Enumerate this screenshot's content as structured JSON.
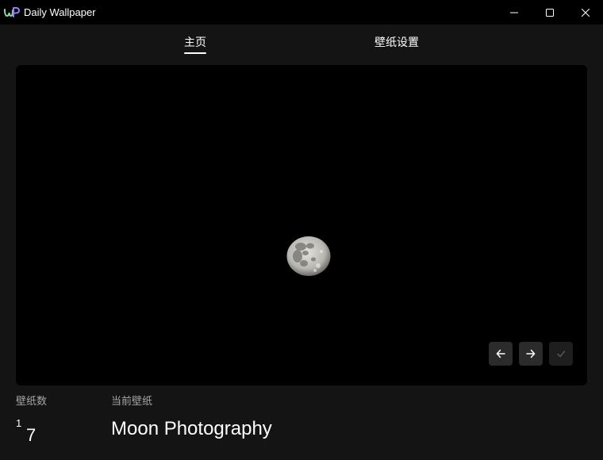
{
  "window": {
    "title": "Daily Wallpaper",
    "logo_icon": "wp-logo-icon",
    "controls": [
      "minimize-icon",
      "maximize-icon",
      "close-icon"
    ]
  },
  "nav": {
    "tabs": [
      {
        "label": "主页",
        "active": true
      },
      {
        "label": "壁纸设置",
        "active": false
      }
    ]
  },
  "preview": {
    "image": "moon-photo",
    "buttons": [
      {
        "icon": "arrow-left-icon",
        "enabled": true
      },
      {
        "icon": "arrow-right-icon",
        "enabled": true
      },
      {
        "icon": "check-icon",
        "enabled": false
      }
    ]
  },
  "info": {
    "count_label": "壁纸数",
    "current_index": "1",
    "total_count": "7",
    "current_label": "当前壁纸",
    "current_title": "Moon Photography"
  },
  "colors": {
    "background": "#141414",
    "titlebar": "#000000",
    "preview_bg": "#000000",
    "button_bg": "#2b2b2b",
    "muted_text": "#a6a6a6",
    "logo_purple": "#9b7cf6",
    "logo_green": "#9be37f"
  }
}
